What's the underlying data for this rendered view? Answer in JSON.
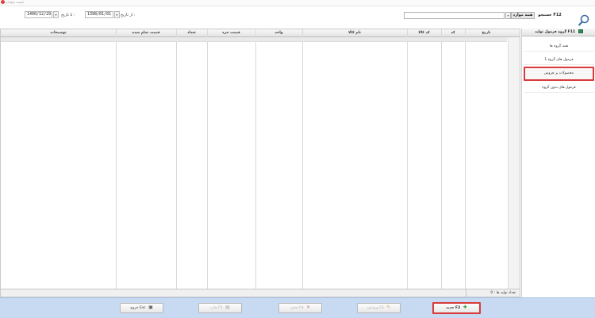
{
  "window": {
    "title": "لیست تولیدات",
    "close_icon": "close-icon"
  },
  "toolbar": {
    "from_date_label": "از تاریخ :",
    "from_date_value": "1398/01/01",
    "to_date_label": "تا تاریخ :",
    "to_date_value": "1400/12/29",
    "search_value": "",
    "filter_value": "همه موارد",
    "search_label": "جستجو F12"
  },
  "grid": {
    "columns": [
      "تاریخ",
      "کد",
      "کد کالا",
      "نام کالا",
      "واحد",
      "قیمت جزء",
      "تعداد",
      "قیمت تمام شده",
      "توضیحات"
    ],
    "rows": [],
    "count_label": "تعداد تولید ها : 0"
  },
  "sidebar": {
    "header": "گروه فرمول تولید F11",
    "items": [
      {
        "label": "همه گروه ها",
        "active": false
      },
      {
        "label": "فرمول های گروه 1",
        "active": false
      },
      {
        "label": "محصولات پر فروش",
        "active": true
      },
      {
        "label": "فرمول های بدون گروه",
        "active": false
      }
    ]
  },
  "buttons": {
    "new": "جدید F2",
    "edit": "ویرایش F3",
    "delete": "حذف F4",
    "print": "چاپ F5",
    "exit": "خروج Esc"
  },
  "colors": {
    "accent": "#d93a3a",
    "bottom_bar": "#c8daf2",
    "new_icon": "#2e9e3a"
  }
}
